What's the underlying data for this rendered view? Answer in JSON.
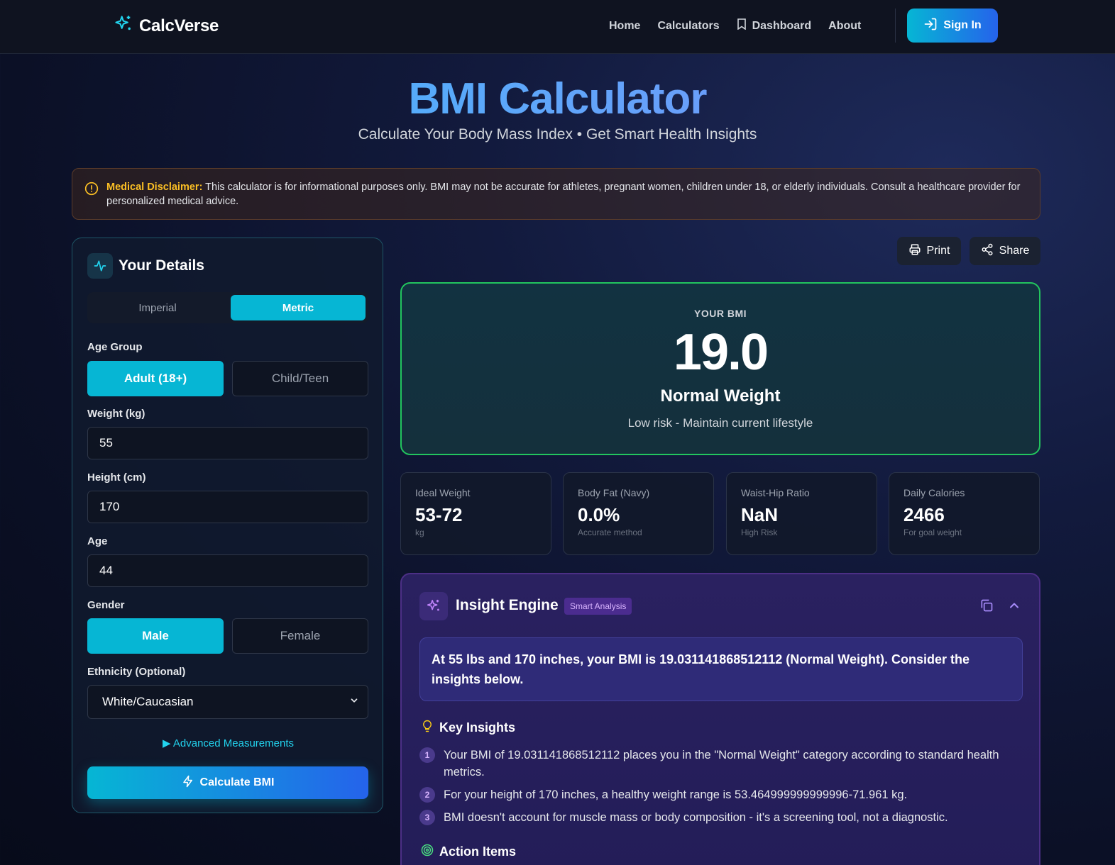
{
  "header": {
    "brand": "CalcVerse",
    "nav": [
      {
        "label": "Home"
      },
      {
        "label": "Calculators"
      },
      {
        "label": "Dashboard",
        "icon": "bookmark-icon"
      },
      {
        "label": "About"
      }
    ],
    "signin_label": "Sign In"
  },
  "hero": {
    "title": "BMI Calculator",
    "subtitle": "Calculate Your Body Mass Index • Get Smart Health Insights"
  },
  "disclaimer": {
    "label": "Medical Disclaimer:",
    "text": " This calculator is for informational purposes only. BMI may not be accurate for athletes, pregnant women, children under 18, or elderly individuals. Consult a healthcare provider for personalized medical advice."
  },
  "form": {
    "title": "Your Details",
    "units": {
      "imperial": "Imperial",
      "metric": "Metric",
      "selected": "Metric"
    },
    "age_group": {
      "label": "Age Group",
      "options": [
        "Adult (18+)",
        "Child/Teen"
      ],
      "selected": "Adult (18+)"
    },
    "weight": {
      "label": "Weight (kg)",
      "value": "55"
    },
    "height": {
      "label": "Height (cm)",
      "value": "170"
    },
    "age": {
      "label": "Age",
      "value": "44"
    },
    "gender": {
      "label": "Gender",
      "options": [
        "Male",
        "Female"
      ],
      "selected": "Male"
    },
    "ethnicity": {
      "label": "Ethnicity (Optional)",
      "value": "White/Caucasian"
    },
    "advanced_label": "Advanced Measurements",
    "calculate_label": "Calculate BMI"
  },
  "actions": {
    "print": "Print",
    "share": "Share"
  },
  "result": {
    "label": "YOUR BMI",
    "value": "19.0",
    "category": "Normal Weight",
    "risk": "Low risk - Maintain current lifestyle",
    "accent_color": "#22c55e"
  },
  "stats": [
    {
      "label": "Ideal Weight",
      "value": "53-72",
      "sub": "kg"
    },
    {
      "label": "Body Fat (Navy)",
      "value": "0.0%",
      "sub": "Accurate method"
    },
    {
      "label": "Waist-Hip Ratio",
      "value": "NaN",
      "sub": "High Risk"
    },
    {
      "label": "Daily Calories",
      "value": "2466",
      "sub": "For goal weight"
    }
  ],
  "insight": {
    "title": "Insight Engine",
    "badge": "Smart Analysis",
    "summary": "At 55 lbs and 170 inches, your BMI is 19.031141868512112 (Normal Weight). Consider the insights below.",
    "key_title": "Key Insights",
    "items": [
      {
        "n": "1",
        "text": "Your BMI of 19.031141868512112 places you in the \"Normal Weight\" category according to standard health metrics."
      },
      {
        "n": "2",
        "text": "For your height of 170 inches, a healthy weight range is 53.464999999999996-71.961 kg."
      },
      {
        "n": "3",
        "text": "BMI doesn't account for muscle mass or body composition - it's a screening tool, not a diagnostic."
      }
    ],
    "action_title": "Action Items"
  }
}
